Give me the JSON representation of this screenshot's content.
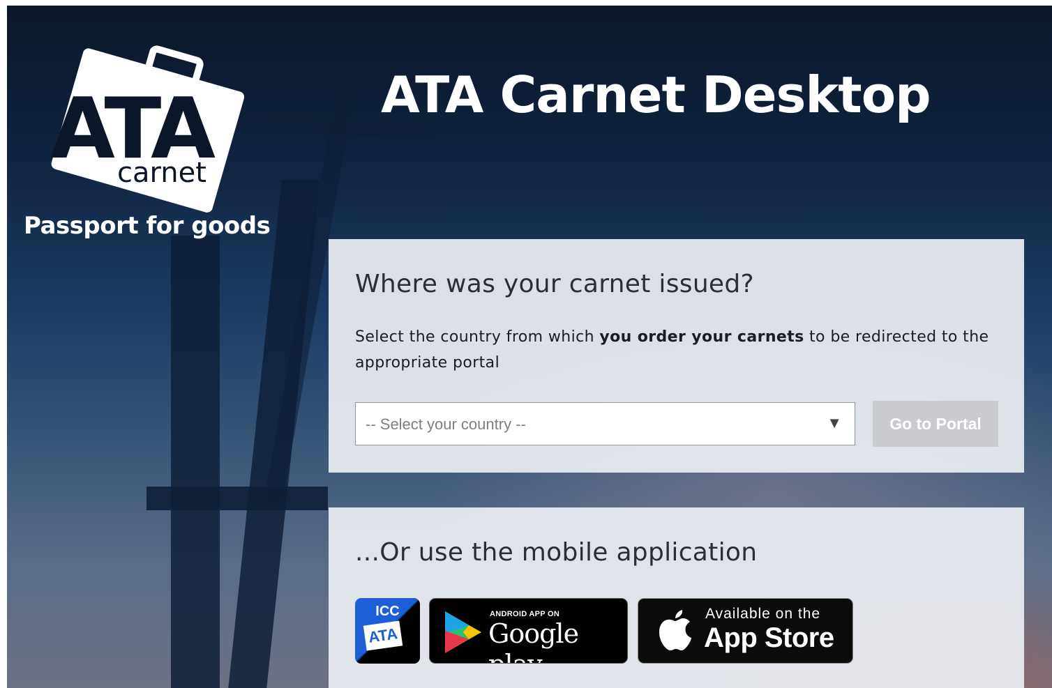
{
  "header": {
    "title": "ATA Carnet Desktop",
    "tagline": "Passport for goods",
    "logo": {
      "big_text": "ATA",
      "small_text": "carnet"
    }
  },
  "portal_panel": {
    "heading": "Where was your carnet issued?",
    "instruction_before": "Select the country from which ",
    "instruction_bold": "you order your carnets",
    "instruction_after": " to be redirected to the appropriate portal",
    "country_select": {
      "placeholder": "-- Select your country --",
      "arrow": "▼"
    },
    "go_button": "Go to Portal"
  },
  "mobile_panel": {
    "heading": "...Or use the mobile application",
    "icc_badge": {
      "top": "ICC",
      "bottom": "ATA"
    },
    "google_play": {
      "small": "ANDROID APP ON",
      "big": "Google play"
    },
    "app_store": {
      "small": "Available on the",
      "big": "App Store"
    }
  },
  "colors": {
    "panel_bg": "#e8ebf0",
    "button_disabled": "#c9cbcf",
    "icc_blue": "#1d5fd6"
  },
  "icons": [
    "ata-carnet-logo",
    "google-play-icon",
    "apple-icon",
    "icc-ata-app-icon",
    "dropdown-arrow-icon"
  ]
}
